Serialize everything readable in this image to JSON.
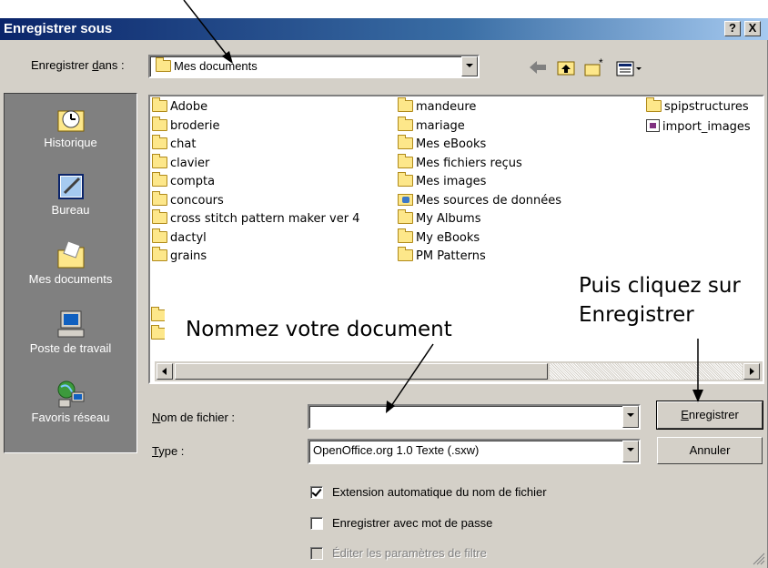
{
  "window": {
    "title": "Enregistrer sous",
    "help_label": "?",
    "close_label": "X"
  },
  "save_in": {
    "label_prefix": "Enregistrer ",
    "label_mnemonic": "d",
    "label_suffix": "ans :",
    "value": "Mes documents"
  },
  "places": [
    {
      "label": "Historique",
      "icon": "history-icon"
    },
    {
      "label": "Bureau",
      "icon": "desktop-icon"
    },
    {
      "label": "Mes documents",
      "icon": "my-documents-icon"
    },
    {
      "label": "Poste de travail",
      "icon": "my-computer-icon"
    },
    {
      "label": "Favoris réseau",
      "icon": "network-places-icon"
    }
  ],
  "files": {
    "col1": [
      "Adobe",
      "broderie",
      "chat",
      "clavier",
      "compta",
      "concours",
      "cross stitch pattern maker ver 4",
      "dactyl",
      "grains"
    ],
    "col2": [
      "mandeure",
      "mariage",
      "Mes eBooks",
      "Mes fichiers reçus",
      "Mes images",
      "Mes sources de données",
      "My Albums",
      "My eBooks",
      "PM Patterns"
    ],
    "col3": [
      "spipstructures",
      "import_images"
    ]
  },
  "annotations": {
    "name_doc": "Nommez votre document",
    "click_line1": "Puis cliquez sur",
    "click_line2": "Enregistrer"
  },
  "filename": {
    "label_mnemonic": "N",
    "label_rest": "om de fichier :",
    "value": ""
  },
  "filetype": {
    "label_mnemonic": "T",
    "label_rest": "ype :",
    "value": "OpenOffice.org 1.0 Texte (.sxw)"
  },
  "buttons": {
    "save_mnemonic": "E",
    "save_rest": "nregistrer",
    "cancel": "Annuler"
  },
  "options": {
    "auto_ext": {
      "label": "Extension automatique du nom de fichier",
      "checked": true
    },
    "password": {
      "label": "Enregistrer avec mot de passe",
      "checked": false
    },
    "filter": {
      "label": "Éditer les paramètres de filtre",
      "checked": false,
      "disabled": true
    }
  }
}
